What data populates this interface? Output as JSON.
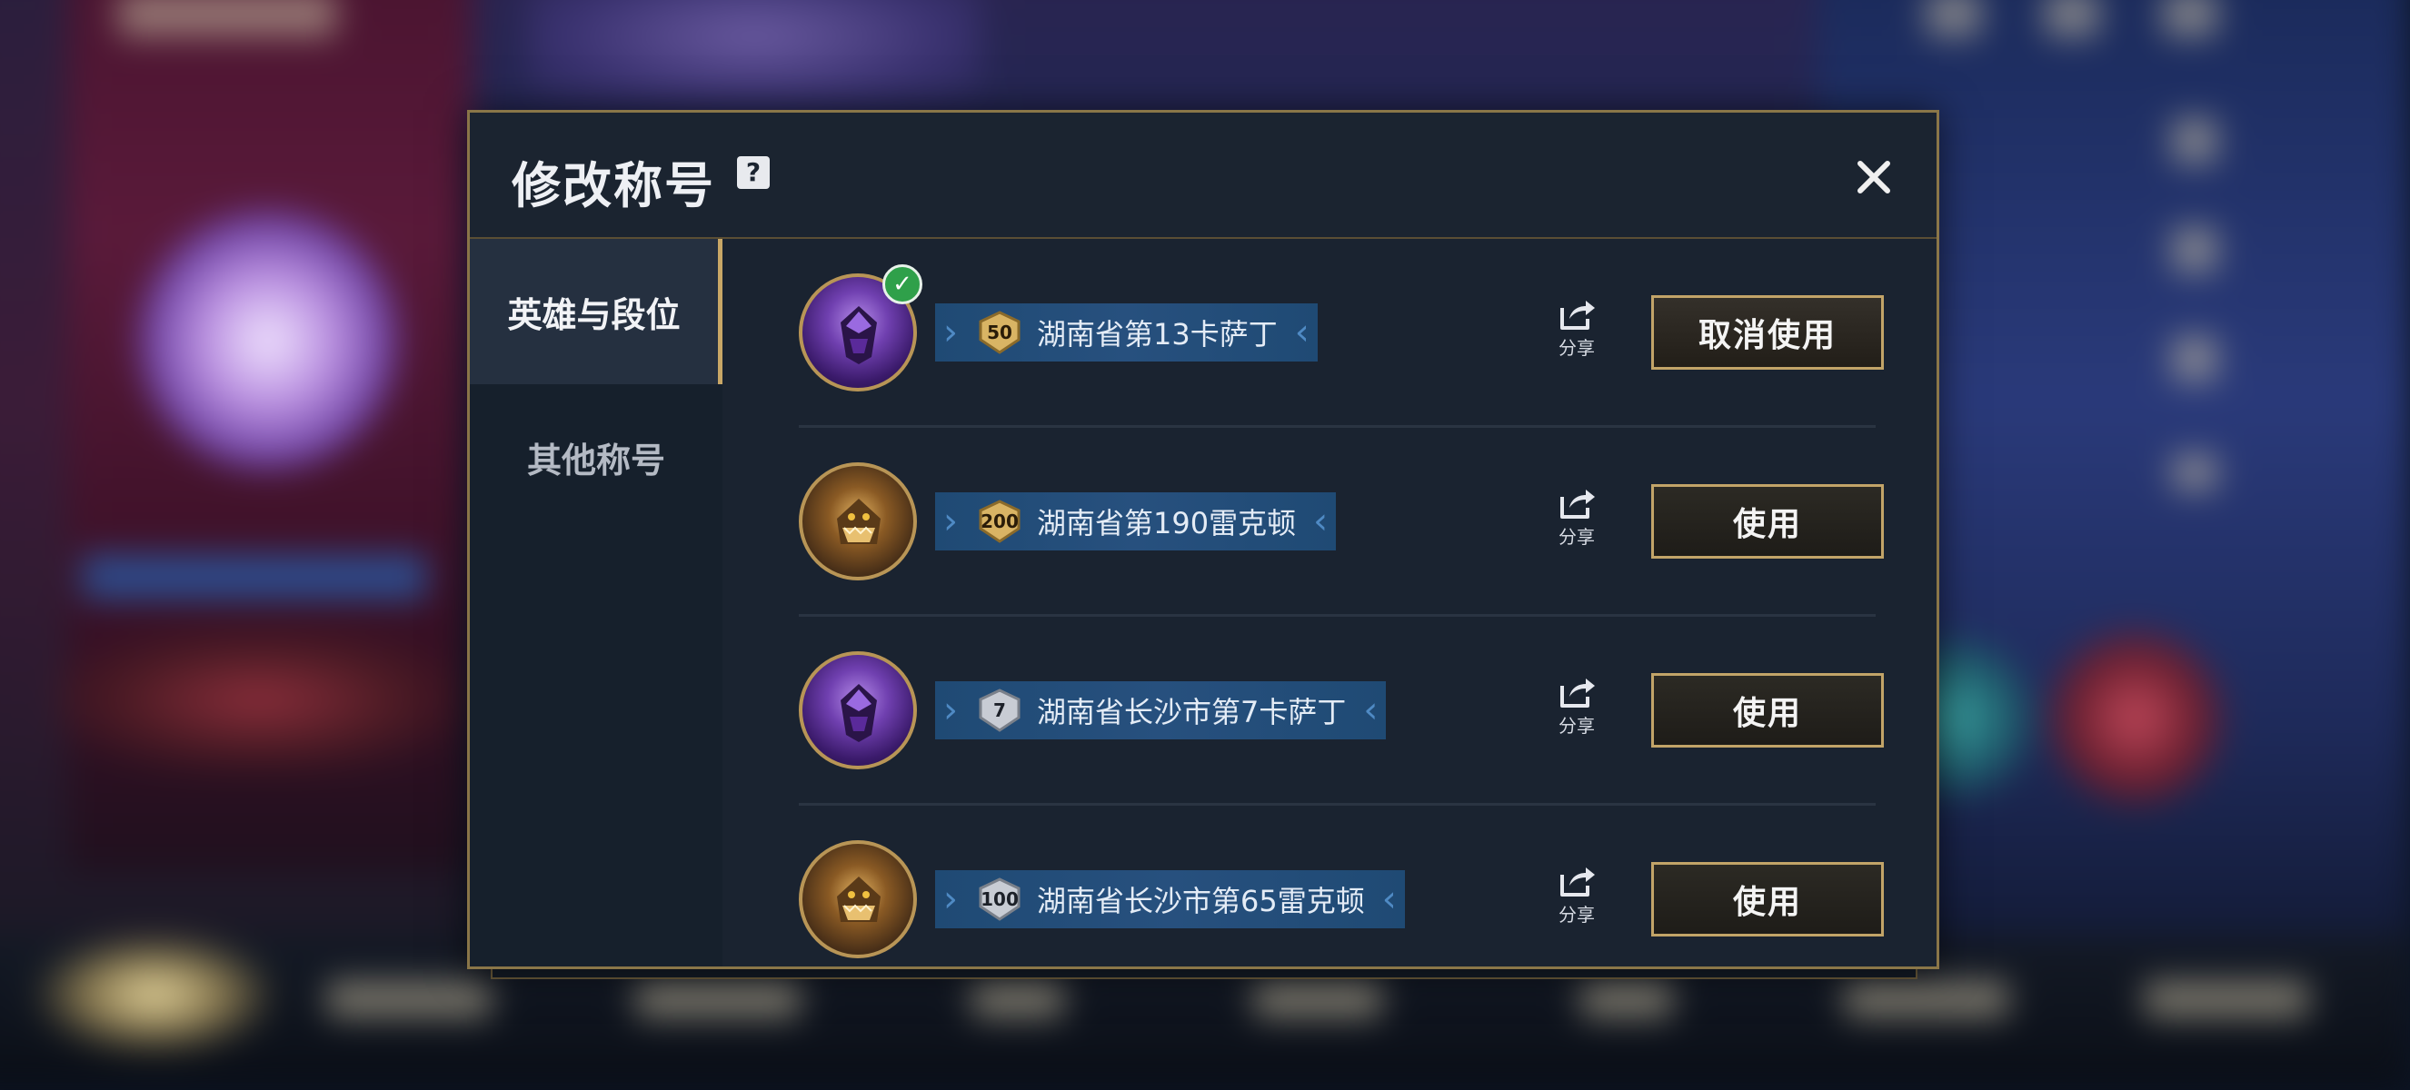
{
  "dialog": {
    "title": "修改称号",
    "help_icon": "question-icon",
    "close_icon": "close-icon"
  },
  "sidebar": {
    "tabs": [
      {
        "label": "英雄与段位",
        "active": true
      },
      {
        "label": "其他称号",
        "active": false
      }
    ]
  },
  "titles": [
    {
      "hero": "卡萨丁",
      "avatar_style": "purple",
      "medal": "50",
      "medal_color": "gold",
      "text": "湖南省第13卡萨丁",
      "in_use": true,
      "share_label": "分享",
      "button_label": "取消使用"
    },
    {
      "hero": "雷克顿",
      "avatar_style": "gold",
      "medal": "200",
      "medal_color": "gold",
      "text": "湖南省第190雷克顿",
      "in_use": false,
      "share_label": "分享",
      "button_label": "使用"
    },
    {
      "hero": "卡萨丁",
      "avatar_style": "purple",
      "medal": "7",
      "medal_color": "silver",
      "text": "湖南省长沙市第7卡萨丁",
      "in_use": false,
      "share_label": "分享",
      "button_label": "使用"
    },
    {
      "hero": "雷克顿",
      "avatar_style": "gold",
      "medal": "100",
      "medal_color": "silver",
      "text": "湖南省长沙市第65雷克顿",
      "in_use": false,
      "share_label": "分享",
      "button_label": "使用"
    }
  ],
  "colors": {
    "accent_gold": "#c2a468",
    "tag_blue": "#27507e",
    "check_green": "#2fa04a"
  }
}
